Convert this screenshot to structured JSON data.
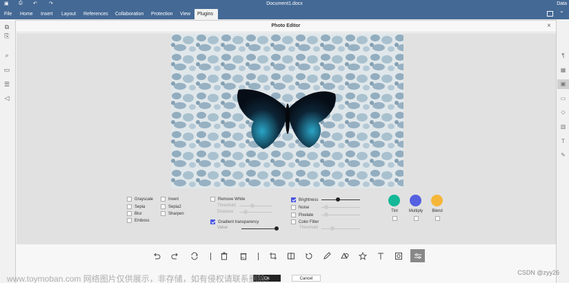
{
  "titlebar": {
    "document_title": "Document1.docx",
    "right_label": "Data"
  },
  "menu": [
    "File",
    "Home",
    "Insert",
    "Layout",
    "References",
    "Collaboration",
    "Protection",
    "View",
    "Plugins"
  ],
  "active_menu": "Plugins",
  "dialog": {
    "title": "Photo Editor",
    "close_label": "×"
  },
  "filters": {
    "col1": [
      "Grayscale",
      "Sepia",
      "Blur",
      "Emboss"
    ],
    "col2": [
      "Invert",
      "Sepia2",
      "Sharpen"
    ],
    "remove_white": {
      "label": "Remove White",
      "threshold_label": "Threshold",
      "distance_label": "Distance"
    },
    "gradient": {
      "label": "Gradient transparency",
      "value_label": "Value",
      "checked": true
    },
    "brightness": {
      "label": "Brightness",
      "checked": true,
      "level": 0.42
    },
    "noise": {
      "label": "Noise"
    },
    "pixelate": {
      "label": "Pixelate"
    },
    "color_filter": {
      "label": "Color Filter",
      "threshold_label": "Threshold"
    }
  },
  "blend_modes": [
    {
      "label": "Tint",
      "color": "#15b897"
    },
    {
      "label": "Multiply",
      "color": "#5561e0"
    },
    {
      "label": "Blend",
      "color": "#f6b63a"
    }
  ],
  "toolbar": {
    "icons": [
      "undo-icon",
      "redo-icon",
      "reset-icon",
      "delete-icon",
      "delete-all-icon",
      "crop-icon",
      "flip-icon",
      "rotate-icon",
      "draw-icon",
      "shape-icon",
      "star-icon",
      "text-icon",
      "mask-icon",
      "filter-icon"
    ],
    "delete_all_text": "ALL"
  },
  "footer": {
    "ok_label": "Ok",
    "cancel_label": "Cancel"
  },
  "watermark": "www.toymoban.com 网络图片仅供展示，非存储，如有侵权请联系删除。",
  "credit": "CSDN @zyy26",
  "colors": {
    "brand": "#446995",
    "accent": "#4a56e2"
  }
}
